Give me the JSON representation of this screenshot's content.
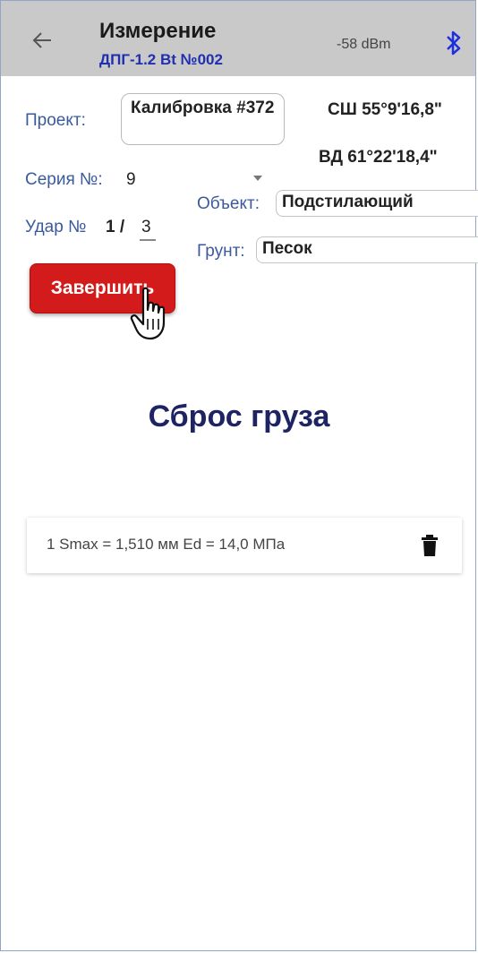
{
  "appbar": {
    "title": "Измерение",
    "subtitle": "ДПГ-1.2 Bt №002",
    "signal": "-58 dBm",
    "back_icon": "arrow-left-icon",
    "bluetooth_icon": "bluetooth-icon"
  },
  "form": {
    "project_label": "Проект:",
    "project_value": "Калибровка #372",
    "series_label": "Серия №:",
    "series_value": "9",
    "strike_label": "Удар №",
    "strike_value": "1 /",
    "strike_total": "3",
    "latitude": "СШ 55°9'16,8\"",
    "longitude": "ВД 61°22'18,4\"",
    "object_label": "Объект:",
    "object_value": "Подстилающий",
    "soil_label": "Грунт:",
    "soil_value": "Песок"
  },
  "actions": {
    "finish_label": "Завершить"
  },
  "main": {
    "heading": "Сброс груза",
    "results": [
      {
        "text": "1  Smax = 1,510 мм   Ed = 14,0 МПа"
      }
    ]
  },
  "colors": {
    "appbar_bg": "#c9c9c9",
    "accent_blue": "#1f2fb0",
    "finish_red": "#d31b1b"
  }
}
